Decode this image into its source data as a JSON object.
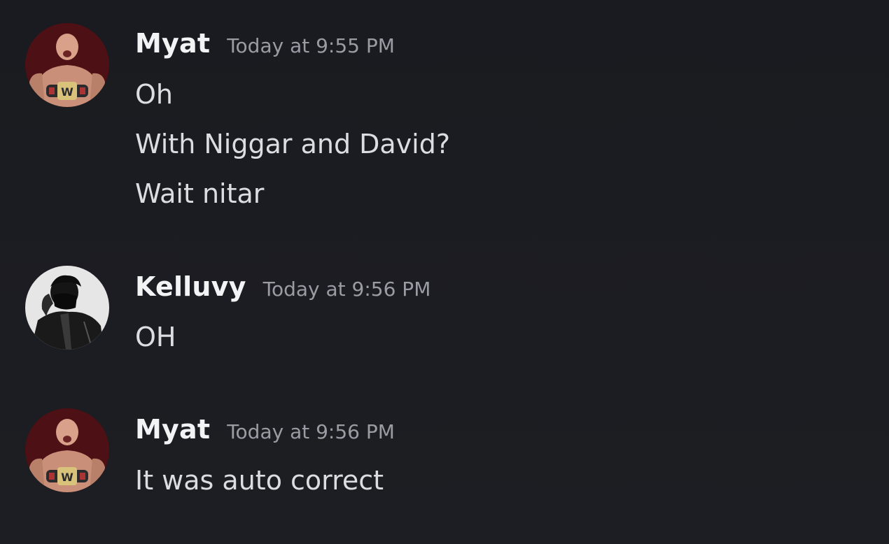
{
  "messages": [
    {
      "username": "Myat",
      "timestamp": "Today at 9:55 PM",
      "lines": [
        "Oh",
        "With Niggar and David?",
        "Wait nitar"
      ]
    },
    {
      "username": "Kelluvy",
      "timestamp": "Today at 9:56 PM",
      "lines": [
        "OH"
      ]
    },
    {
      "username": "Myat",
      "timestamp": "Today at 9:56 PM",
      "lines": [
        "It was auto correct"
      ]
    }
  ],
  "colors": {
    "background": "#1c1d22",
    "username": "#f2f3f5",
    "timestamp": "#9a9ca4",
    "message_text": "#dcdde1"
  }
}
